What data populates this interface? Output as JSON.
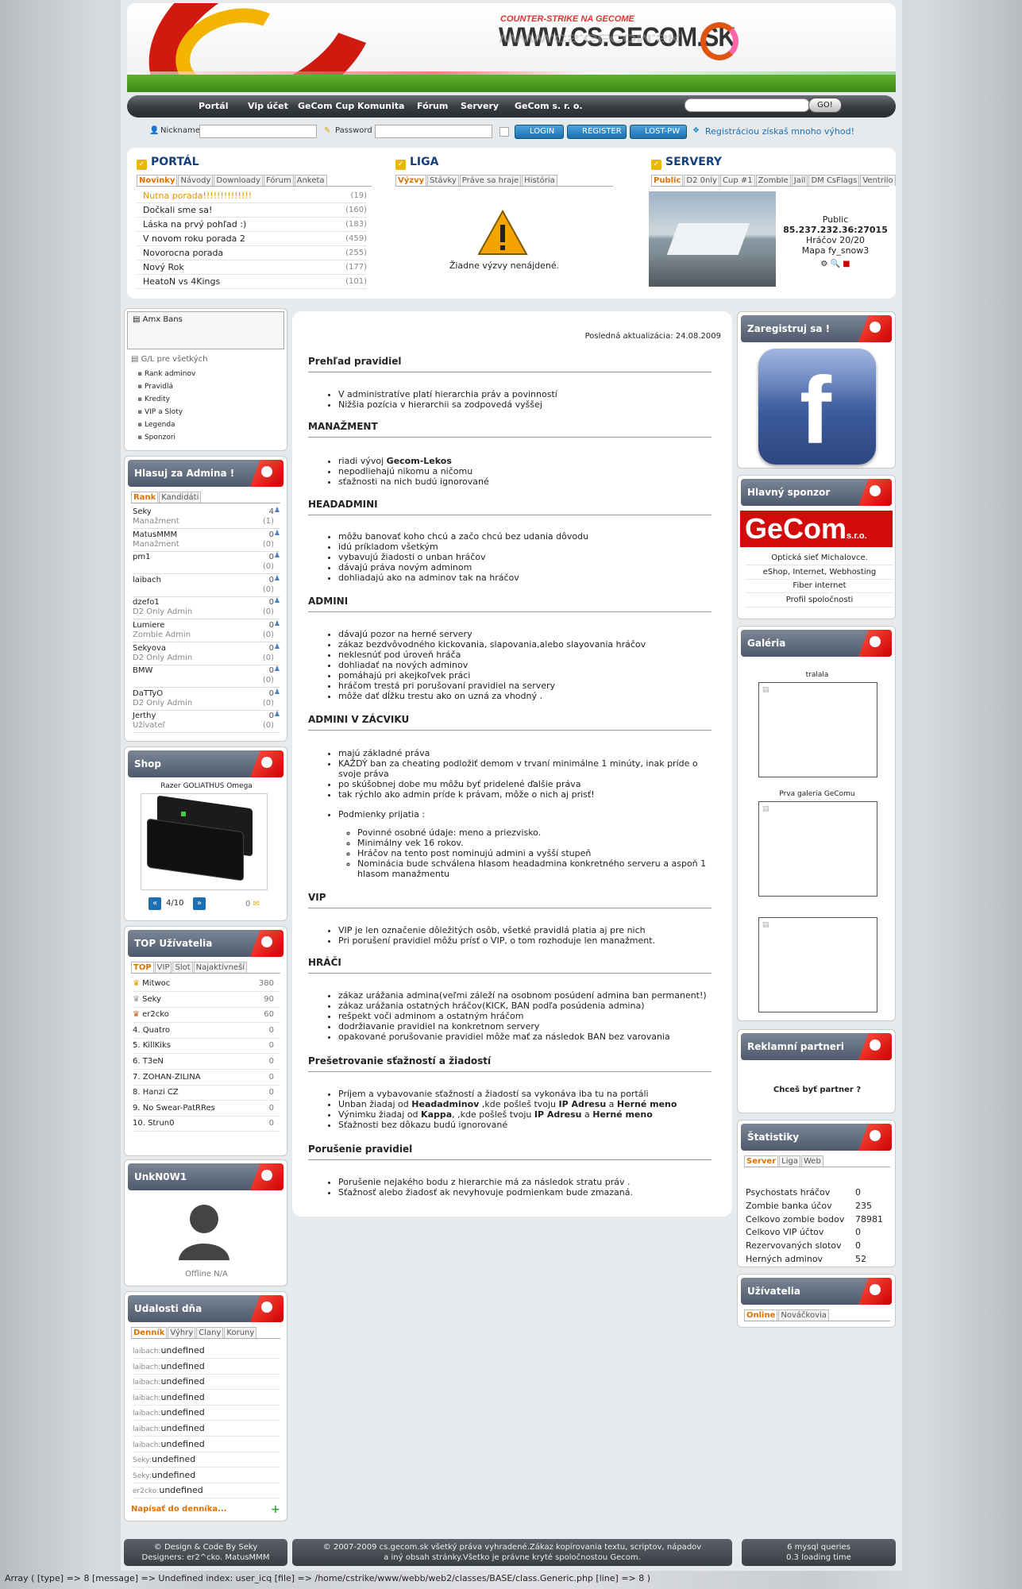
{
  "header": {
    "logo_small": "COUNTER-STRIKE NA GECOME",
    "logo_big": "WWW.CS.GECOM.SK",
    "logo_g": "G"
  },
  "nav": {
    "items": [
      "Portál",
      "Vip účet",
      "GeCom Cup",
      "Komunita",
      "Fórum",
      "Servery",
      "GeCom s. r. o."
    ],
    "go": "GO!"
  },
  "login": {
    "nickname": "Nickname",
    "password": "Password",
    "login_btn": "LOGIN",
    "register_btn": "REGISTER",
    "lostpw_btn": "LOST-PW",
    "promo": "Registráciou získaš mnoho výhod!"
  },
  "portal": {
    "title": "PORTÁL",
    "tabs": [
      "Novinky",
      "Návody",
      "Downloady",
      "Fórum",
      "Anketa"
    ],
    "news": [
      {
        "t": "Nutna porada!!!!!!!!!!!!!!",
        "c": "(19)"
      },
      {
        "t": "Dočkali sme sa!",
        "c": "(160)"
      },
      {
        "t": "Láska na prvý pohľad :)",
        "c": "(183)"
      },
      {
        "t": "V novom roku porada 2",
        "c": "(459)"
      },
      {
        "t": "Novorocna porada",
        "c": "(255)"
      },
      {
        "t": "Nový Rok",
        "c": "(177)"
      },
      {
        "t": "HeatoN vs 4Kings",
        "c": "(101)"
      }
    ]
  },
  "liga": {
    "title": "LIGA",
    "tabs": [
      "Výzvy",
      "Stávky",
      "Práve sa hraje",
      "História"
    ],
    "empty": "Žiadne výzvy nenájdené."
  },
  "servery": {
    "title": "SERVERY",
    "tabs": [
      "Public",
      "D2 0nly",
      "Cup #1",
      "ZombIe",
      "Jail",
      "DM CsFlags",
      "Ventrilo"
    ],
    "name": "Public",
    "ip": "85.237.232.36:27015",
    "players": "Hráčov 20/20",
    "map": "Mapa fy_snow3"
  },
  "leftmenu": {
    "amx": "Amx Bans",
    "group": "G/L pre všetkých",
    "items": [
      "Rank adminov",
      "Pravidlá",
      "Kredity",
      "VIP a Sloty",
      "Legenda",
      "Sponzori"
    ]
  },
  "hlasuj": {
    "title": "Hlasuj za Admina !",
    "tabs": [
      "Rank",
      "Kandidáti"
    ],
    "rows": [
      {
        "n": "Seky",
        "r": "Manažment",
        "v1": "4",
        "v2": "(1)"
      },
      {
        "n": "MatusMMM",
        "r": "Manažment",
        "v1": "0",
        "v2": "(0)"
      },
      {
        "n": "pm1",
        "r": "",
        "v1": "0",
        "v2": "(0)"
      },
      {
        "n": "laibach",
        "r": "",
        "v1": "0",
        "v2": "(0)"
      },
      {
        "n": "dzefo1",
        "r": "D2 Only Admin",
        "v1": "0",
        "v2": "(0)"
      },
      {
        "n": "Lumiere",
        "r": "Zombie Admin",
        "v1": "0",
        "v2": "(0)"
      },
      {
        "n": "Sekyova",
        "r": "D2 Only Admin",
        "v1": "0",
        "v2": "(0)"
      },
      {
        "n": "BMW",
        "r": "",
        "v1": "0",
        "v2": "(0)"
      },
      {
        "n": "DaTTyO",
        "r": "D2 Only Admin",
        "v1": "0",
        "v2": "(0)"
      },
      {
        "n": "Jerthy",
        "r": "Užívateľ",
        "v1": "0",
        "v2": "(0)"
      }
    ]
  },
  "shop": {
    "title": "Shop",
    "product": "Razer GOLIATHUS Omega",
    "pager": "4/10",
    "count": "0"
  },
  "top": {
    "title": "TOP Užívatelia",
    "tabs": [
      "TOP",
      "VIP",
      "Slot",
      "Najaktívneší"
    ],
    "rows": [
      {
        "n": "Mitwoc",
        "v": "380"
      },
      {
        "n": "Seky",
        "v": "90"
      },
      {
        "n": "er2cko",
        "v": "60"
      },
      {
        "n": "4. Quatro",
        "v": "0"
      },
      {
        "n": "5. KillKiks",
        "v": "0"
      },
      {
        "n": "6. T3eN",
        "v": "0"
      },
      {
        "n": "7. ZOHAN-ZILINA",
        "v": "0"
      },
      {
        "n": "8. Hanzi CZ",
        "v": "0"
      },
      {
        "n": "9. No Swear-PatRRes",
        "v": "0"
      },
      {
        "n": "10. Strun0",
        "v": "0"
      }
    ]
  },
  "user": {
    "title": "UnkN0W1",
    "status": "Offline N/A"
  },
  "events": {
    "title": "Udalosti dňa",
    "tabs": [
      "Denník",
      "Výhry",
      "Clany",
      "Koruny"
    ],
    "rows": [
      {
        "u": "laibach:",
        "t": "undefined"
      },
      {
        "u": "laibach:",
        "t": "undefined"
      },
      {
        "u": "laibach:",
        "t": "undefined"
      },
      {
        "u": "laibach:",
        "t": "undefined"
      },
      {
        "u": "laibach:",
        "t": "undefined"
      },
      {
        "u": "laibach:",
        "t": "undefined"
      },
      {
        "u": "laibach:",
        "t": "undefined"
      },
      {
        "u": "Seky:",
        "t": "undefined"
      },
      {
        "u": "Seky:",
        "t": "undefined"
      },
      {
        "u": "er2cko:",
        "t": "undefined"
      }
    ],
    "write": "Napísať do denníka..."
  },
  "main": {
    "updated": "Posledná aktualizácia: 24.08.2009",
    "s1": "Prehľad pravidiel",
    "s1_items": [
      "V administratíve platí hierarchia práv a povinností",
      "Nižšia pozícia v hierarchii sa zodpovedá vyššej"
    ],
    "s2": "MANAŽMENT",
    "s2_items": [
      "riadi vývoj ",
      "nepodliehajú nikomu a ničomu",
      "sťažnosti na nich budú ignorované"
    ],
    "s2_bold": "Gecom-Lekos",
    "s3": "HEADADMINI",
    "s3_items": [
      "môžu banovať koho chcú a začo chcú bez udania dôvodu",
      "idú príkladom všetkým",
      "vybavujú žiadosti o unban hráčov",
      "dávajú práva novým adminom",
      "dohliadajú ako na adminov tak na hráčov"
    ],
    "s4": "ADMINI",
    "s4_items": [
      "dávajú pozor na herné servery",
      "zákaz bezdvôvodného kickovania, slapovania,alebo slayovania hráčov",
      "neklesnúť pod úroveň hráča",
      "dohliadať na nových adminov",
      "pomáhajú pri akejkoľvek práci",
      "hráčom trestá pri porušovaní pravidiel na servery",
      "môže dať dĺžku trestu ako on uzná za vhodný ."
    ],
    "s5": "ADMINI V ZÁCVIKU",
    "s5_items": [
      "majú základné práva",
      "KAŽDÝ ban za cheating podložiť demom v trvaní minimálne 1 minúty, inak príde o svoje práva",
      "po skúšobnej dobe mu môžu byť pridelené ďalšie práva",
      "tak rýchlo ako admin príde k právam, môže o nich aj prisť!"
    ],
    "s5_cond": "Podmienky prijatia :",
    "s5_sub": [
      "Povinné osobné údaje: meno a priezvisko.",
      "Minimálny vek 16 rokov.",
      "Hráčov na tento post nominujú admini a vyšší stupeň",
      "Nominácia bude schválena hlasom headadmina konkretného serveru a aspoň 1 hlasom manažmentu"
    ],
    "s6": "VIP",
    "s6_items": [
      "VIP je len označenie dôležitých osôb, všetké pravidlá platia aj pre nich",
      "Pri porušení pravidiel môžu prísť o VIP, o tom rozhoduje len manažment."
    ],
    "s7": "HRÁČI",
    "s7_items": [
      "zákaz urážania admina(veľmi záleží na osobnom posúdení admina ban permanent!)",
      "zákaz urážania ostatných hráčov(KICK, BAN podľa posúdenia admina)",
      "rešpekt voči adminom a ostatným hráčom",
      "dodržiavanie pravidiel na konkretnom servery",
      "opakované porušovanie pravidiel môže mať za následok BAN bez varovania"
    ],
    "s8": "Prešetrovanie sťažností a žiadostí",
    "s8_i1": "Príjem a vybavovanie sťažností a žiadostí sa vykonáva iba tu na portáli",
    "s8_i2a": "Unban žiadaj od ",
    "s8_i2b": "Headadminov",
    "s8_i2c": " ,kde pošleš tvoju ",
    "s8_i2d": "IP Adresu",
    "s8_i2e": " a ",
    "s8_i2f": "Herné meno",
    "s8_i3a": "Výnimku žiadaj od ",
    "s8_i3b": "Kappa",
    "s8_i3c": ", ,kde pošleš tvoju ",
    "s8_i3d": "IP Adresu",
    "s8_i3e": " a ",
    "s8_i3f": "Herné meno",
    "s8_i4": "Sťažnosti bez dôkazu budú ignorované",
    "s9": "Porušenie pravidiel",
    "s9_items": [
      "Porušenie nejakého bodu z hierarchie má za následok stratu práv .",
      "Sťažnosť alebo žiadosť ak nevyhovuje podmienkam bude zmazaná."
    ]
  },
  "right": {
    "register": "Zaregistruj sa !",
    "sponsor_title": "Hlavný sponzor",
    "sponsor_logo": "GeCom",
    "sponsor_sro": "s.r.o.",
    "sponsor_items": [
      "Optická sieť Michalovce.",
      "eShop, Internet, Webhosting",
      "Fiber internet",
      "Profil spoločnosti"
    ],
    "gallery_title": "Galéria",
    "gallery": [
      "tralala",
      "Prva galeria GeComu",
      ""
    ],
    "ads_title": "Reklamní partneri",
    "ads_link": "Chceš byť partner ?",
    "stats_title": "Štatistiky",
    "stats_tabs": [
      "Server",
      "Liga",
      "Web"
    ],
    "stats": [
      {
        "k": "Psychostats hráčov",
        "v": "0"
      },
      {
        "k": "Zombie banka účov",
        "v": "235"
      },
      {
        "k": "Celkovo zombie bodov",
        "v": "78981"
      },
      {
        "k": "Celkovo VIP účtov",
        "v": "0"
      },
      {
        "k": "Rezervovaných slotov",
        "v": "0"
      },
      {
        "k": "Herných adminov",
        "v": "52"
      }
    ],
    "users_title": "Užívatelia",
    "users_tabs": [
      "Online",
      "Nováčkovia"
    ]
  },
  "footer": {
    "left1": "© Design & Code By Seky",
    "left2": "Designers: er2^cko. MatusMMM",
    "mid1": "© 2007-2009 cs.gecom.sk všetký práva vyhradené.Zákaz kopírovania textu, scriptov, nápadov",
    "mid2": "a iný obsah stránky.Všetko je právne kryté spoločnostou Gecom.",
    "right1": "6 mysql queries",
    "right2": "0.3 loading time"
  },
  "debug": "Array ( [type] => 8 [message] => Undefined index: user_icq [file] => /home/cstrike/www/webb/web2/classes/BASE/class.Generic.php [line] => 8 )"
}
